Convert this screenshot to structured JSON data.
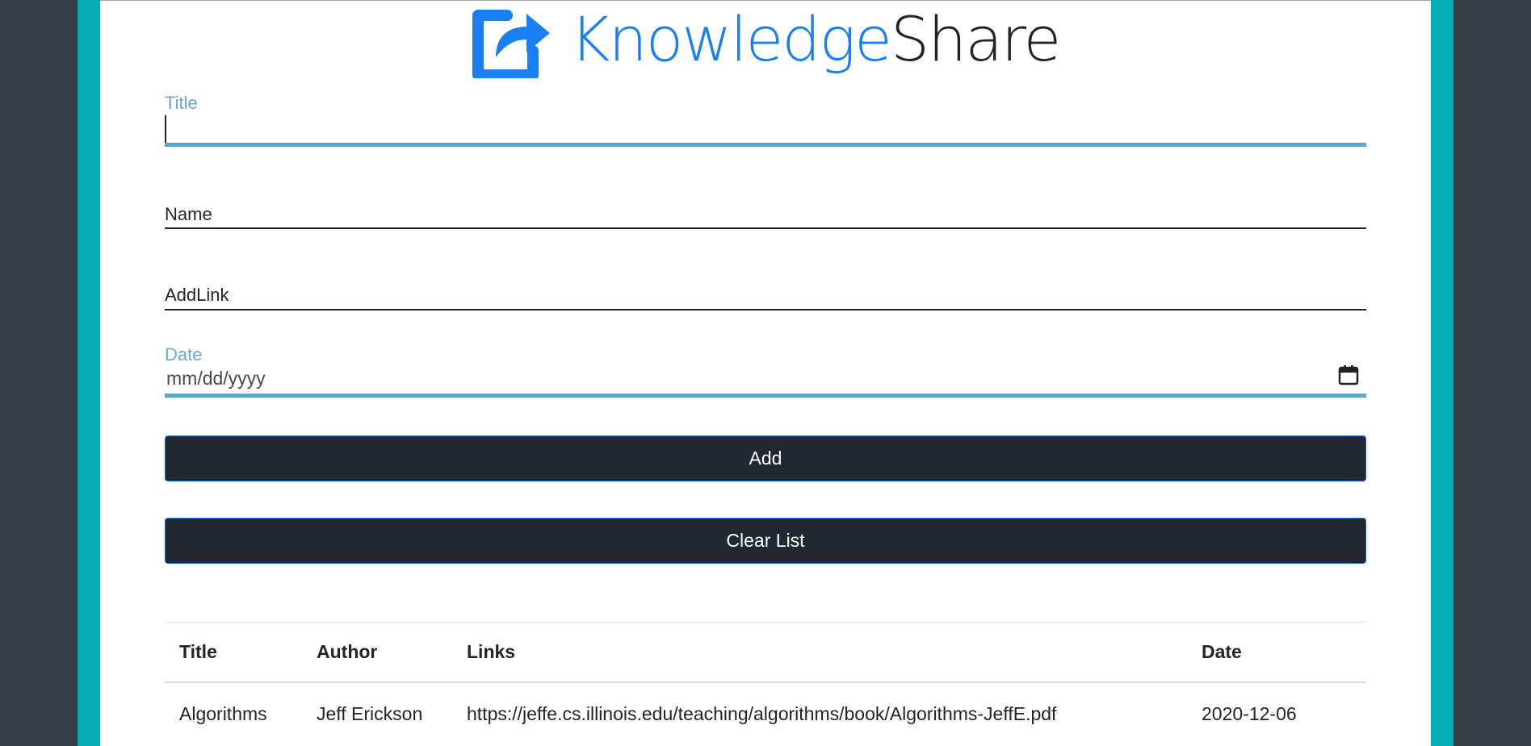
{
  "brand": {
    "name_part1": "Knowledge",
    "name_part2": "Share",
    "logo_icon": "share-square-icon",
    "primary_color": "#1a7ff2"
  },
  "form": {
    "title_label": "Title",
    "title_value": "",
    "name_label": "Name",
    "name_value": "",
    "link_label": "AddLink",
    "link_value": "",
    "date_label": "Date",
    "date_placeholder": "mm/dd/yyyy",
    "calendar_icon": "calendar-icon"
  },
  "buttons": {
    "add_label": "Add",
    "clear_label": "Clear List"
  },
  "table": {
    "headers": [
      "Title",
      "Author",
      "Links",
      "Date"
    ],
    "rows": [
      [
        "Algorithms",
        "Jeff Erickson",
        "https://jeffe.cs.illinois.edu/teaching/algorithms/book/Algorithms-JeffE.pdf",
        "2020-12-06"
      ]
    ]
  },
  "colors": {
    "frame": "#00adb5",
    "outer_background": "#373c44",
    "button": "#222831",
    "focus_line": "#5fa3cf"
  }
}
